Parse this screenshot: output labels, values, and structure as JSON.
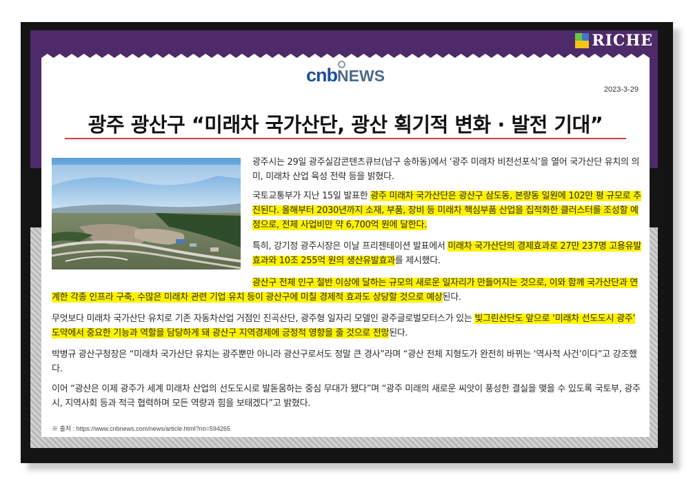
{
  "brand": {
    "name": "RICHE"
  },
  "logo": {
    "cnb": "cnb",
    "news": "NEWS"
  },
  "article": {
    "date": "2023-3-29",
    "headline": "광주 광산구 “미래차 국가산단, 광산 획기적 변화 · 발전 기대”",
    "p1": "광주시는 29일 광주실감콘텐츠큐브(남구 송하동)에서 ‘광주 미래차 비전선포식’을 열어 국가산단 유치의 의미, 미래차 산업 육성 전략 등을 밝혔다.",
    "p2_a": "국토교통부가 지난 15일 발표한 ",
    "p2_hl": "광주 미래차 국가산단은 광산구 삼도동, 본량동 일원에 102만 평 규모로 추진된다. 올해부터 2030년까지 소재, 부품, 장비 등 미래차 핵심부품 산업을 집적화한 클러스터를 조성할 예정으로, 전체 사업비만 약 6,700억 원에 달한다.",
    "p3_a": "특히, 강기정 광주시장은 이날 프리젠테이션 발표에서 ",
    "p3_hl": "미래차 국가산단의 경제효과로 27만 237명 고용유발효과와 10조 255억 원의 생산유발효과",
    "p3_b": "를 제시했다.",
    "p4_hl": "광산구 전체 인구 절반 이상에 달하는 규모의 새로운 일자리가 만들어지는 것으로, 이와 함께 국가산단과 연계한 각종 인프라 구축, 수많은 미래차 관련 기업 유치 등이 광산구에 미칠 경제적 효과도 상당할 것으로 예상",
    "p4_b": "된다.",
    "p5_a": "무엇보다 미래차 국가산단 유치로 기존 자동차산업 거점인 진곡산단, 광주형 일자리 모델인 광주글로벌모터스가 있는 ",
    "p5_hl": "빛그린산단도 앞으로 ‘미래차 선도도시 광주’ 도약에서 중요한 기능과 역할을 담당하게 돼 광산구 지역경제에 긍정적 영향을 줄 것으로 전망",
    "p5_b": "된다.",
    "p6": "박병규 광산구청장은 “미래차 국가산단 유치는 광주뿐만 아니라 광산구로서도 정말 큰 경사”라며 “광산 전체 지형도가 완전히 바뀌는 ‘역사적 사건’이다”고 강조했다.",
    "p7": "이어 “광산은 이제 광주가 세계 미래차 산업의 선도도시로 발돋움하는 중심 무대가 됐다”며 “광주 미래의 새로운 씨앗이 풍성한 결실을 맺을 수 있도록 국토부, 광주시, 지역사회 등과 적극 협력하며 모든 역량과 힘을 보태겠다”고 밝혔다.",
    "source": "※ 출처 : https://www.cnbnews.com/news/article.html?no=594265"
  },
  "colors": {
    "purple": "#4e2a6a",
    "highlight": "#fff200",
    "underline": "#d83a3a",
    "logo_blue": "#1b4f9a"
  }
}
